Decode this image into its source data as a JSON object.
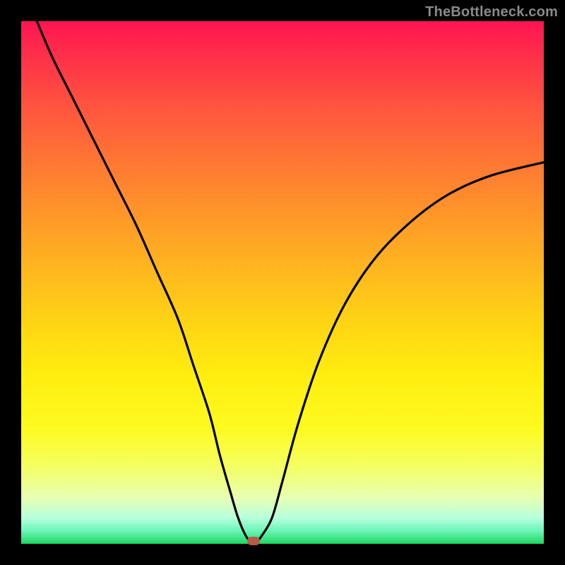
{
  "watermark": "TheBottleneck.com",
  "marker_color": "#b85a4a",
  "chart_data": {
    "type": "line",
    "title": "",
    "xlabel": "",
    "ylabel": "",
    "xlim": [
      0,
      100
    ],
    "ylim": [
      0,
      100
    ],
    "x": [
      3,
      6,
      10,
      14,
      18,
      22,
      26,
      30,
      33,
      36,
      38,
      40,
      41.5,
      43,
      44,
      45,
      46,
      48,
      50,
      53,
      57,
      62,
      68,
      75,
      82,
      90,
      100
    ],
    "values": [
      100,
      93,
      85,
      77,
      69,
      61,
      52,
      43,
      34,
      25,
      17,
      10,
      5,
      1.5,
      0.5,
      0.5,
      1.5,
      5,
      12,
      23,
      35,
      46,
      55,
      62,
      67,
      70.5,
      73
    ],
    "series": [
      {
        "name": "bottleneck-curve",
        "color": "#000000"
      }
    ],
    "marker": {
      "x": 44.5,
      "y": 0.5
    },
    "gradient_stops": [
      {
        "pos": 0,
        "color": "#ff1452"
      },
      {
        "pos": 0.5,
        "color": "#ffee0f"
      },
      {
        "pos": 1.0,
        "color": "#1ed760"
      }
    ]
  }
}
